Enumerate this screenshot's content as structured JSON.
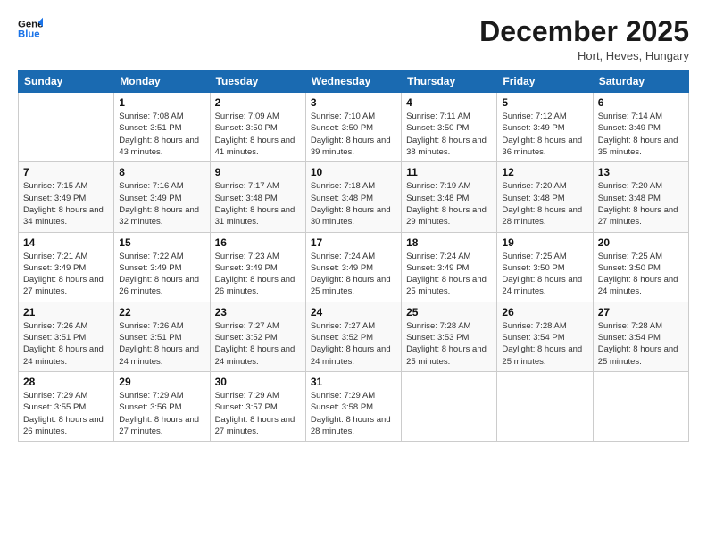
{
  "logo": {
    "line1": "General",
    "line2": "Blue"
  },
  "title": "December 2025",
  "subtitle": "Hort, Heves, Hungary",
  "days_header": [
    "Sunday",
    "Monday",
    "Tuesday",
    "Wednesday",
    "Thursday",
    "Friday",
    "Saturday"
  ],
  "weeks": [
    [
      {
        "day": "",
        "sunrise": "",
        "sunset": "",
        "daylight": ""
      },
      {
        "day": "1",
        "sunrise": "Sunrise: 7:08 AM",
        "sunset": "Sunset: 3:51 PM",
        "daylight": "Daylight: 8 hours and 43 minutes."
      },
      {
        "day": "2",
        "sunrise": "Sunrise: 7:09 AM",
        "sunset": "Sunset: 3:50 PM",
        "daylight": "Daylight: 8 hours and 41 minutes."
      },
      {
        "day": "3",
        "sunrise": "Sunrise: 7:10 AM",
        "sunset": "Sunset: 3:50 PM",
        "daylight": "Daylight: 8 hours and 39 minutes."
      },
      {
        "day": "4",
        "sunrise": "Sunrise: 7:11 AM",
        "sunset": "Sunset: 3:50 PM",
        "daylight": "Daylight: 8 hours and 38 minutes."
      },
      {
        "day": "5",
        "sunrise": "Sunrise: 7:12 AM",
        "sunset": "Sunset: 3:49 PM",
        "daylight": "Daylight: 8 hours and 36 minutes."
      },
      {
        "day": "6",
        "sunrise": "Sunrise: 7:14 AM",
        "sunset": "Sunset: 3:49 PM",
        "daylight": "Daylight: 8 hours and 35 minutes."
      }
    ],
    [
      {
        "day": "7",
        "sunrise": "Sunrise: 7:15 AM",
        "sunset": "Sunset: 3:49 PM",
        "daylight": "Daylight: 8 hours and 34 minutes."
      },
      {
        "day": "8",
        "sunrise": "Sunrise: 7:16 AM",
        "sunset": "Sunset: 3:49 PM",
        "daylight": "Daylight: 8 hours and 32 minutes."
      },
      {
        "day": "9",
        "sunrise": "Sunrise: 7:17 AM",
        "sunset": "Sunset: 3:48 PM",
        "daylight": "Daylight: 8 hours and 31 minutes."
      },
      {
        "day": "10",
        "sunrise": "Sunrise: 7:18 AM",
        "sunset": "Sunset: 3:48 PM",
        "daylight": "Daylight: 8 hours and 30 minutes."
      },
      {
        "day": "11",
        "sunrise": "Sunrise: 7:19 AM",
        "sunset": "Sunset: 3:48 PM",
        "daylight": "Daylight: 8 hours and 29 minutes."
      },
      {
        "day": "12",
        "sunrise": "Sunrise: 7:20 AM",
        "sunset": "Sunset: 3:48 PM",
        "daylight": "Daylight: 8 hours and 28 minutes."
      },
      {
        "day": "13",
        "sunrise": "Sunrise: 7:20 AM",
        "sunset": "Sunset: 3:48 PM",
        "daylight": "Daylight: 8 hours and 27 minutes."
      }
    ],
    [
      {
        "day": "14",
        "sunrise": "Sunrise: 7:21 AM",
        "sunset": "Sunset: 3:49 PM",
        "daylight": "Daylight: 8 hours and 27 minutes."
      },
      {
        "day": "15",
        "sunrise": "Sunrise: 7:22 AM",
        "sunset": "Sunset: 3:49 PM",
        "daylight": "Daylight: 8 hours and 26 minutes."
      },
      {
        "day": "16",
        "sunrise": "Sunrise: 7:23 AM",
        "sunset": "Sunset: 3:49 PM",
        "daylight": "Daylight: 8 hours and 26 minutes."
      },
      {
        "day": "17",
        "sunrise": "Sunrise: 7:24 AM",
        "sunset": "Sunset: 3:49 PM",
        "daylight": "Daylight: 8 hours and 25 minutes."
      },
      {
        "day": "18",
        "sunrise": "Sunrise: 7:24 AM",
        "sunset": "Sunset: 3:49 PM",
        "daylight": "Daylight: 8 hours and 25 minutes."
      },
      {
        "day": "19",
        "sunrise": "Sunrise: 7:25 AM",
        "sunset": "Sunset: 3:50 PM",
        "daylight": "Daylight: 8 hours and 24 minutes."
      },
      {
        "day": "20",
        "sunrise": "Sunrise: 7:25 AM",
        "sunset": "Sunset: 3:50 PM",
        "daylight": "Daylight: 8 hours and 24 minutes."
      }
    ],
    [
      {
        "day": "21",
        "sunrise": "Sunrise: 7:26 AM",
        "sunset": "Sunset: 3:51 PM",
        "daylight": "Daylight: 8 hours and 24 minutes."
      },
      {
        "day": "22",
        "sunrise": "Sunrise: 7:26 AM",
        "sunset": "Sunset: 3:51 PM",
        "daylight": "Daylight: 8 hours and 24 minutes."
      },
      {
        "day": "23",
        "sunrise": "Sunrise: 7:27 AM",
        "sunset": "Sunset: 3:52 PM",
        "daylight": "Daylight: 8 hours and 24 minutes."
      },
      {
        "day": "24",
        "sunrise": "Sunrise: 7:27 AM",
        "sunset": "Sunset: 3:52 PM",
        "daylight": "Daylight: 8 hours and 24 minutes."
      },
      {
        "day": "25",
        "sunrise": "Sunrise: 7:28 AM",
        "sunset": "Sunset: 3:53 PM",
        "daylight": "Daylight: 8 hours and 25 minutes."
      },
      {
        "day": "26",
        "sunrise": "Sunrise: 7:28 AM",
        "sunset": "Sunset: 3:54 PM",
        "daylight": "Daylight: 8 hours and 25 minutes."
      },
      {
        "day": "27",
        "sunrise": "Sunrise: 7:28 AM",
        "sunset": "Sunset: 3:54 PM",
        "daylight": "Daylight: 8 hours and 25 minutes."
      }
    ],
    [
      {
        "day": "28",
        "sunrise": "Sunrise: 7:29 AM",
        "sunset": "Sunset: 3:55 PM",
        "daylight": "Daylight: 8 hours and 26 minutes."
      },
      {
        "day": "29",
        "sunrise": "Sunrise: 7:29 AM",
        "sunset": "Sunset: 3:56 PM",
        "daylight": "Daylight: 8 hours and 27 minutes."
      },
      {
        "day": "30",
        "sunrise": "Sunrise: 7:29 AM",
        "sunset": "Sunset: 3:57 PM",
        "daylight": "Daylight: 8 hours and 27 minutes."
      },
      {
        "day": "31",
        "sunrise": "Sunrise: 7:29 AM",
        "sunset": "Sunset: 3:58 PM",
        "daylight": "Daylight: 8 hours and 28 minutes."
      },
      {
        "day": "",
        "sunrise": "",
        "sunset": "",
        "daylight": ""
      },
      {
        "day": "",
        "sunrise": "",
        "sunset": "",
        "daylight": ""
      },
      {
        "day": "",
        "sunrise": "",
        "sunset": "",
        "daylight": ""
      }
    ]
  ]
}
